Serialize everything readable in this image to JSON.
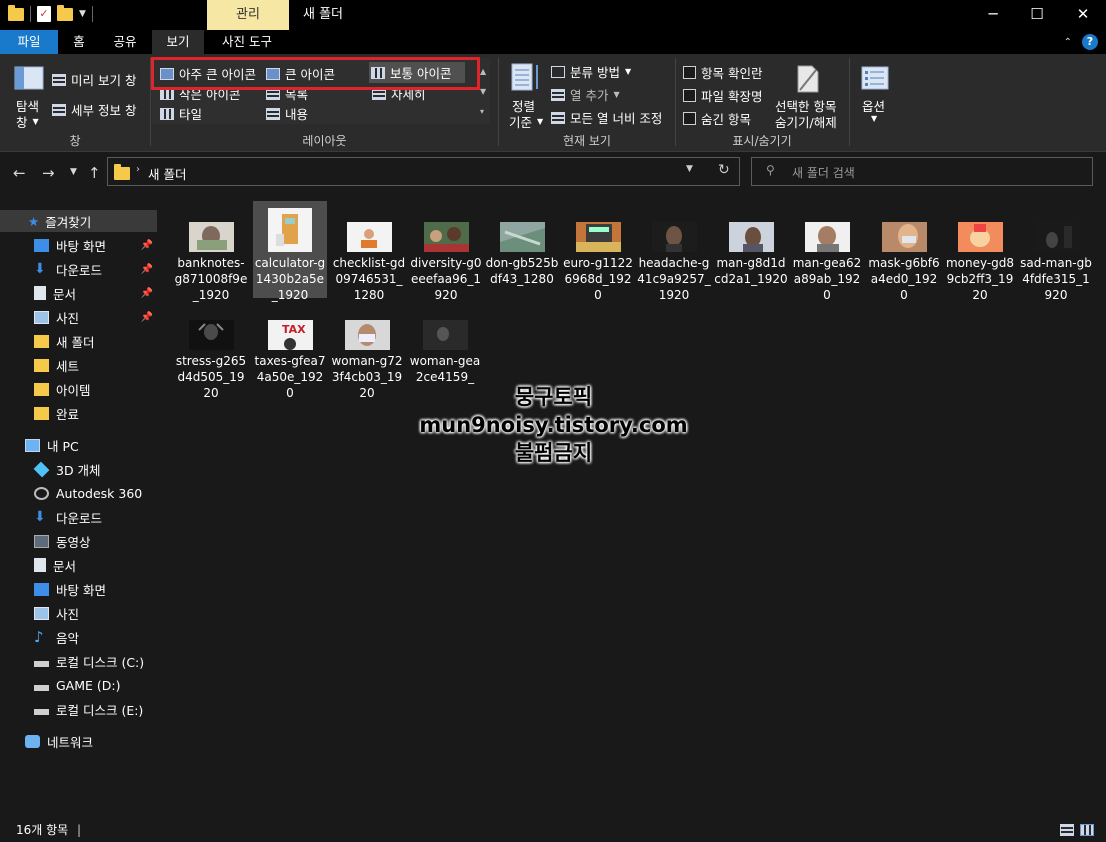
{
  "titlebar": {
    "manage_tab": "관리",
    "title": "새 폴더",
    "minimize": "─",
    "maximize": "☐",
    "close": "✕"
  },
  "tabs": {
    "file": "파일",
    "home": "홈",
    "share": "공유",
    "view": "보기",
    "picture_tools": "사진 도구"
  },
  "ribbon": {
    "pane": {
      "nav_pane_line1": "탐색",
      "nav_pane_line2": "창",
      "preview_pane": "미리 보기 창",
      "details_pane": "세부 정보 창",
      "group_label": "창"
    },
    "layout": {
      "extra_large": "아주 큰 아이콘",
      "large": "큰 아이콘",
      "medium": "보통 아이콘",
      "small": "작은 아이콘",
      "list": "목록",
      "details": "자세히",
      "tiles": "타일",
      "content": "내용",
      "group_label": "레이아웃"
    },
    "current_view": {
      "sort_line1": "정렬",
      "sort_line2": "기준",
      "group_by": "분류 방법",
      "add_columns": "열 추가",
      "size_all_columns": "모든 열 너비 조정",
      "group_label": "현재 보기"
    },
    "show_hide": {
      "item_checkboxes": "항목 확인란",
      "file_extensions": "파일 확장명",
      "hidden_items": "숨긴 항목",
      "hide_selected_line1": "선택한 항목",
      "hide_selected_line2": "숨기기/해제",
      "group_label": "표시/숨기기"
    },
    "options": {
      "label": "옵션"
    }
  },
  "address": {
    "path": "새 폴더",
    "search_placeholder": "새 폴더 검색"
  },
  "nav_pane": {
    "quick_access": "즐겨찾기",
    "quick_items": [
      "바탕 화면",
      "다운로드",
      "문서",
      "사진",
      "새 폴더",
      "세트",
      "아이템",
      "완료"
    ],
    "this_pc": "내 PC",
    "pc_items": [
      "3D 개체",
      "Autodesk 360",
      "다운로드",
      "동영상",
      "문서",
      "바탕 화면",
      "사진",
      "음악",
      "로컬 디스크 (C:)",
      "GAME (D:)",
      "로컬 디스크 (E:)"
    ],
    "network": "네트워크"
  },
  "files": [
    "banknotes-g871008f9e_1920",
    "calculator-g1430b2a5e_1920",
    "checklist-gd09746531_1280",
    "diversity-g0eeefaa96_1920",
    "don-gb525bdf43_1280",
    "euro-g11226968d_1920",
    "headache-g41c9a9257_1920",
    "man-g8d1dcd2a1_1920",
    "man-gea62a89ab_1920",
    "mask-g6bf6a4ed0_1920",
    "money-gd89cb2ff3_1920",
    "sad-man-gb4fdfe315_1920",
    "stress-g265d4d505_1920",
    "taxes-gfea74a50e_1920",
    "woman-g723f4cb03_1920",
    "woman-gea2ce4159_"
  ],
  "watermark": {
    "line1": "뭉구토픽",
    "line2": "mun9noisy.tistory.com",
    "line3": "불펌금지"
  },
  "status": {
    "count": "16개 항목"
  },
  "colors": {
    "accent": "#1979ca",
    "highlight_box": "#e0242b",
    "manage_tab": "#f6e7a5"
  }
}
